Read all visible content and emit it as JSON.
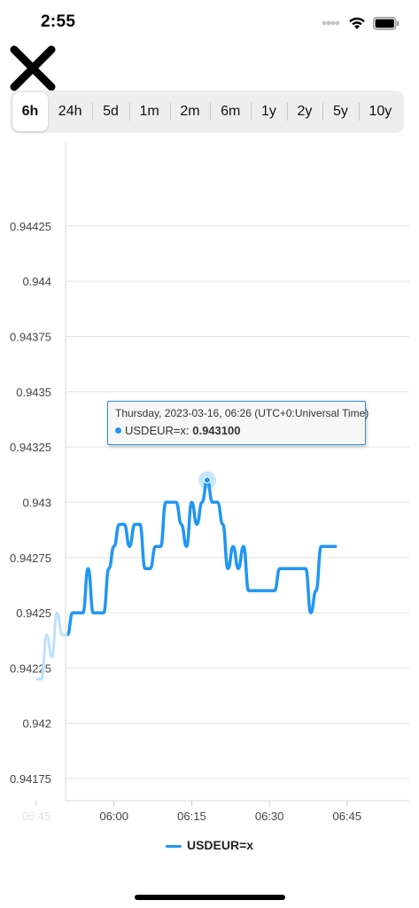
{
  "status_bar": {
    "time": "2:55"
  },
  "toolbar": {
    "close_icon": "x-icon"
  },
  "ranges": {
    "selected": "6h",
    "items": [
      "6h",
      "24h",
      "5d",
      "1m",
      "2m",
      "6m",
      "1y",
      "2y",
      "5y",
      "10y"
    ]
  },
  "colors": {
    "series": "#2196f3",
    "series_faded": "#bfe0fb",
    "tooltip_border": "#2d8ddf"
  },
  "tooltip": {
    "date": "Thursday, 2023-03-16, 06:26 (UTC+0:Universal Time)",
    "series_name": "USDEUR=x",
    "value": "0.943100"
  },
  "legend": {
    "label": "USDEUR=x"
  },
  "chart_data": {
    "type": "line",
    "title": "",
    "xlabel": "",
    "ylabel": "",
    "x_ticks": [
      "05:45",
      "06:00",
      "06:15",
      "06:30",
      "06:45"
    ],
    "y_ticks": [
      "0.94425",
      "0.944",
      "0.94375",
      "0.9435",
      "0.94325",
      "0.943",
      "0.94275",
      "0.9425",
      "0.94225",
      "0.942",
      "0.94175"
    ],
    "ylim": [
      0.94165,
      0.94455
    ],
    "grid": true,
    "legend_position": "bottom",
    "series": [
      {
        "name": "USDEUR=x",
        "points": [
          {
            "t": "05:45",
            "y": 0.9422
          },
          {
            "t": "05:46",
            "y": 0.9422
          },
          {
            "t": "05:47",
            "y": 0.9424
          },
          {
            "t": "05:48",
            "y": 0.9423
          },
          {
            "t": "05:49",
            "y": 0.9425
          },
          {
            "t": "05:50",
            "y": 0.9424
          },
          {
            "t": "05:51",
            "y": 0.9424
          },
          {
            "t": "05:52",
            "y": 0.9425
          },
          {
            "t": "05:53",
            "y": 0.9425
          },
          {
            "t": "05:54",
            "y": 0.9425
          },
          {
            "t": "05:55",
            "y": 0.9427
          },
          {
            "t": "05:56",
            "y": 0.9425
          },
          {
            "t": "05:57",
            "y": 0.9425
          },
          {
            "t": "05:58",
            "y": 0.9425
          },
          {
            "t": "05:59",
            "y": 0.9427
          },
          {
            "t": "06:00",
            "y": 0.9428
          },
          {
            "t": "06:01",
            "y": 0.9429
          },
          {
            "t": "06:02",
            "y": 0.9429
          },
          {
            "t": "06:03",
            "y": 0.9428
          },
          {
            "t": "06:04",
            "y": 0.9429
          },
          {
            "t": "06:05",
            "y": 0.9429
          },
          {
            "t": "06:06",
            "y": 0.9427
          },
          {
            "t": "06:07",
            "y": 0.9427
          },
          {
            "t": "06:08",
            "y": 0.9428
          },
          {
            "t": "06:09",
            "y": 0.9428
          },
          {
            "t": "06:10",
            "y": 0.943
          },
          {
            "t": "06:11",
            "y": 0.943
          },
          {
            "t": "06:12",
            "y": 0.943
          },
          {
            "t": "06:13",
            "y": 0.9429
          },
          {
            "t": "06:14",
            "y": 0.9428
          },
          {
            "t": "06:15",
            "y": 0.943
          },
          {
            "t": "06:16",
            "y": 0.9429
          },
          {
            "t": "06:17",
            "y": 0.943
          },
          {
            "t": "06:18",
            "y": 0.9431
          },
          {
            "t": "06:19",
            "y": 0.943
          },
          {
            "t": "06:20",
            "y": 0.943
          },
          {
            "t": "06:21",
            "y": 0.9429
          },
          {
            "t": "06:22",
            "y": 0.9427
          },
          {
            "t": "06:23",
            "y": 0.9428
          },
          {
            "t": "06:24",
            "y": 0.9427
          },
          {
            "t": "06:25",
            "y": 0.9428
          },
          {
            "t": "06:26",
            "y": 0.9426
          },
          {
            "t": "06:27",
            "y": 0.9426
          },
          {
            "t": "06:28",
            "y": 0.9426
          },
          {
            "t": "06:29",
            "y": 0.9426
          },
          {
            "t": "06:30",
            "y": 0.9426
          },
          {
            "t": "06:31",
            "y": 0.9426
          },
          {
            "t": "06:32",
            "y": 0.9427
          },
          {
            "t": "06:33",
            "y": 0.9427
          },
          {
            "t": "06:34",
            "y": 0.9427
          },
          {
            "t": "06:35",
            "y": 0.9427
          },
          {
            "t": "06:36",
            "y": 0.9427
          },
          {
            "t": "06:37",
            "y": 0.9427
          },
          {
            "t": "06:38",
            "y": 0.9425
          },
          {
            "t": "06:39",
            "y": 0.9426
          },
          {
            "t": "06:40",
            "y": 0.9428
          },
          {
            "t": "06:41",
            "y": 0.9428
          },
          {
            "t": "06:42",
            "y": 0.9428
          },
          {
            "t": "06:43",
            "y": 0.9428
          }
        ]
      }
    ]
  }
}
